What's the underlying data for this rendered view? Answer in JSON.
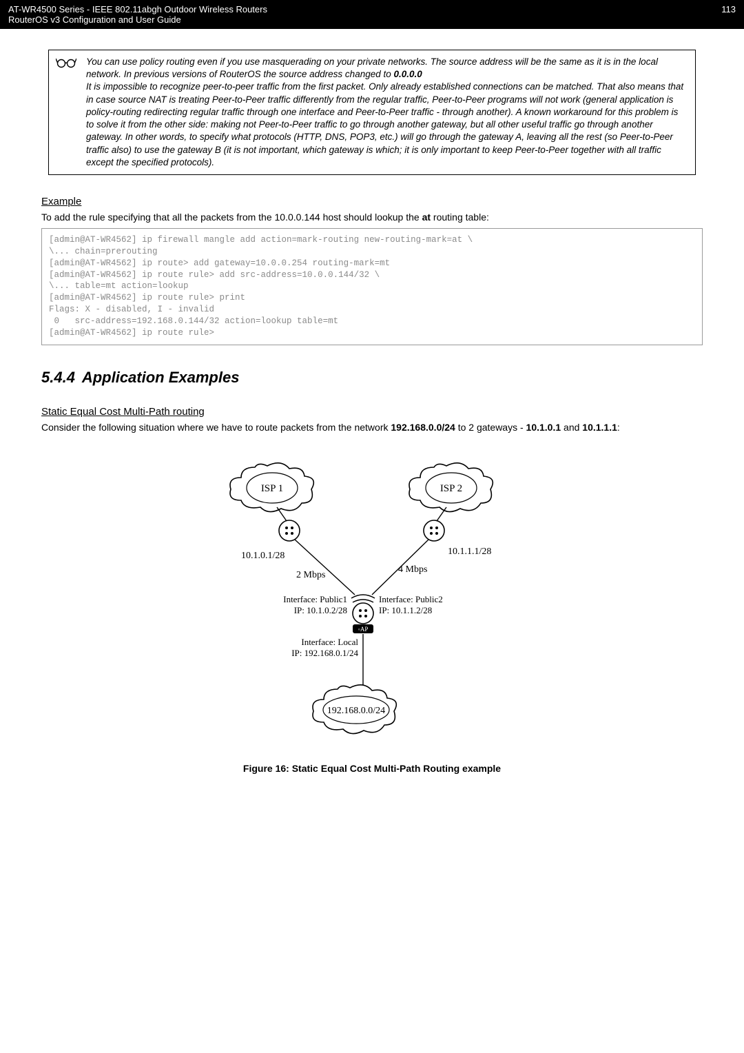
{
  "header": {
    "left_line1": "AT-WR4500 Series - IEEE 802.11abgh Outdoor Wireless Routers",
    "left_line2": "RouterOS v3 Configuration and User Guide",
    "page": "113"
  },
  "info": {
    "part1a": "You can use policy routing even if you use masquerading on your private networks. The source address will be the same as it is in the local network. In previous versions of RouterOS the source address changed to ",
    "part1_bold": "0.0.0.0",
    "part2": "It is impossible to recognize peer-to-peer traffic from the first packet. Only already established connections can be matched. That also means that in case source NAT is treating Peer-to-Peer traffic differently from the regular traffic, Peer-to-Peer programs will not work (general application is policy-routing redirecting regular traffic through one interface and Peer-to-Peer traffic - through another). A known workaround for this problem is to solve it from the other side: making not Peer-to-Peer traffic to go through another gateway, but all other useful traffic go through another gateway. In other words, to specify what protocols (HTTP, DNS, POP3, etc.) will go through the gateway A, leaving all the rest (so Peer-to-Peer traffic also) to use the gateway B (it is not important, which gateway is which; it is only important to keep Peer-to-Peer together with all traffic except the specified protocols)."
  },
  "example": {
    "heading": "Example",
    "lead_a": "To add the rule specifying that all the packets from the 10.0.0.144 host should lookup the ",
    "lead_bold": "at",
    "lead_b": " routing table:",
    "code": "[admin@AT-WR4562] ip firewall mangle add action=mark-routing new-routing-mark=at \\\n\\... chain=prerouting\n[admin@AT-WR4562] ip route> add gateway=10.0.0.254 routing-mark=mt\n[admin@AT-WR4562] ip route rule> add src-address=10.0.0.144/32 \\\n\\... table=mt action=lookup\n[admin@AT-WR4562] ip route rule> print\nFlags: X - disabled, I - invalid\n 0   src-address=192.168.0.144/32 action=lookup table=mt\n[admin@AT-WR4562] ip route rule>"
  },
  "chapter": {
    "num": "5.4.4",
    "title": "Application Examples"
  },
  "static": {
    "heading": "Static Equal Cost Multi-Path routing",
    "lead_a": "Consider the following situation where we have to route packets from the network ",
    "net": "192.168.0.0/24",
    "lead_b": " to 2 gateways - ",
    "gw1": "10.1.0.1",
    "lead_c": " and ",
    "gw2": "10.1.1.1",
    "lead_d": ":"
  },
  "diagram": {
    "isp1": "ISP 1",
    "isp2": "ISP 2",
    "left_net": "10.1.0.1/28",
    "right_net": "10.1.1.1/28",
    "left_bw": "2 Mbps",
    "right_bw": "4 Mbps",
    "if_pub1_name": "Interface: Public1",
    "if_pub1_ip": "IP: 10.1.0.2/28",
    "if_pub2_name": "Interface: Public2",
    "if_pub2_ip": "IP: 10.1.1.2/28",
    "if_local_name": "Interface: Local",
    "if_local_ip": "IP: 192.168.0.1/24",
    "bottom_net": "192.168.0.0/24",
    "ap_badge": "AP"
  },
  "figure": {
    "caption": "Figure 16: Static Equal Cost Multi-Path Routing example"
  }
}
